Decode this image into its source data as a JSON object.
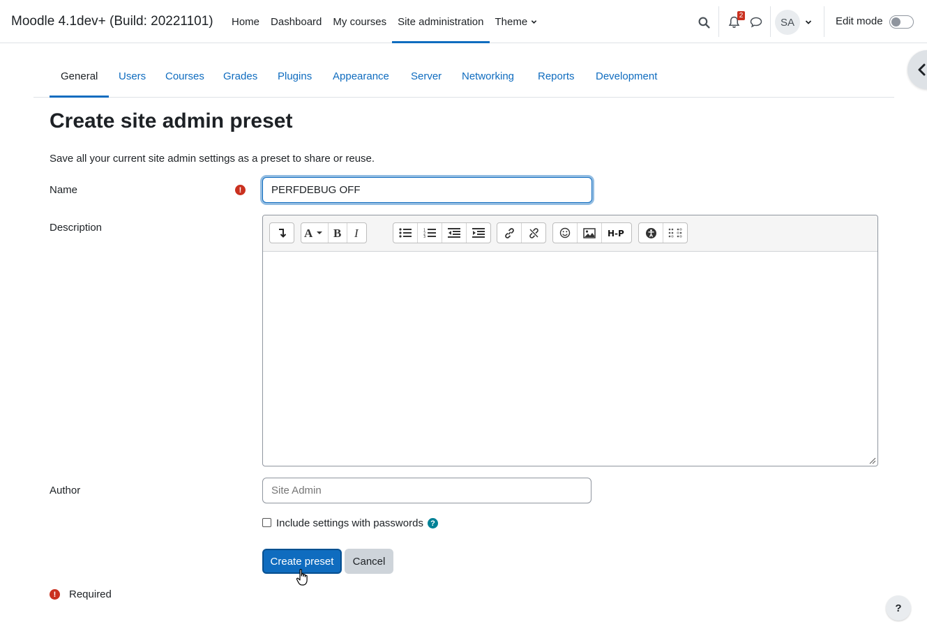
{
  "site": {
    "brand": "Moodle 4.1dev+ (Build: 20221101)"
  },
  "primary_nav": {
    "items": [
      {
        "label": "Home"
      },
      {
        "label": "Dashboard"
      },
      {
        "label": "My courses"
      },
      {
        "label": "Site administration",
        "active": true
      },
      {
        "label": "Theme"
      }
    ]
  },
  "user_menu": {
    "notification_count": "2",
    "avatar_initials": "SA",
    "edit_mode_label": "Edit mode",
    "edit_mode_on": false
  },
  "secondary_nav": {
    "tabs": [
      {
        "label": "General",
        "active": true
      },
      {
        "label": "Users"
      },
      {
        "label": "Courses"
      },
      {
        "label": "Grades"
      },
      {
        "label": "Plugins"
      },
      {
        "label": "Appearance"
      },
      {
        "label": "Server"
      },
      {
        "label": "Networking"
      },
      {
        "label": "Reports"
      },
      {
        "label": "Development"
      }
    ]
  },
  "page": {
    "title": "Create site admin preset",
    "intro": "Save all your current site admin settings as a preset to share or reuse."
  },
  "form": {
    "name_label": "Name",
    "name_value": "PERFDEBUG OFF",
    "description_label": "Description",
    "author_label": "Author",
    "author_placeholder": "Site Admin",
    "include_passwords_label": "Include settings with passwords",
    "include_passwords_checked": false,
    "submit_label": "Create preset",
    "cancel_label": "Cancel",
    "required_label": "Required"
  },
  "editor_toolbar": {
    "buttons": [
      "collapse-icon",
      "font-color-icon",
      "bold-icon",
      "italic-icon",
      "unordered-list-icon",
      "ordered-list-icon",
      "outdent-icon",
      "indent-icon",
      "link-icon",
      "unlink-icon",
      "emoji-icon",
      "image-icon",
      "h5p-icon",
      "accessibility-checker-icon",
      "screenreader-helper-icon"
    ]
  },
  "colors": {
    "accent": "#0f6cbf",
    "danger": "#ca3120",
    "info": "#008196"
  }
}
